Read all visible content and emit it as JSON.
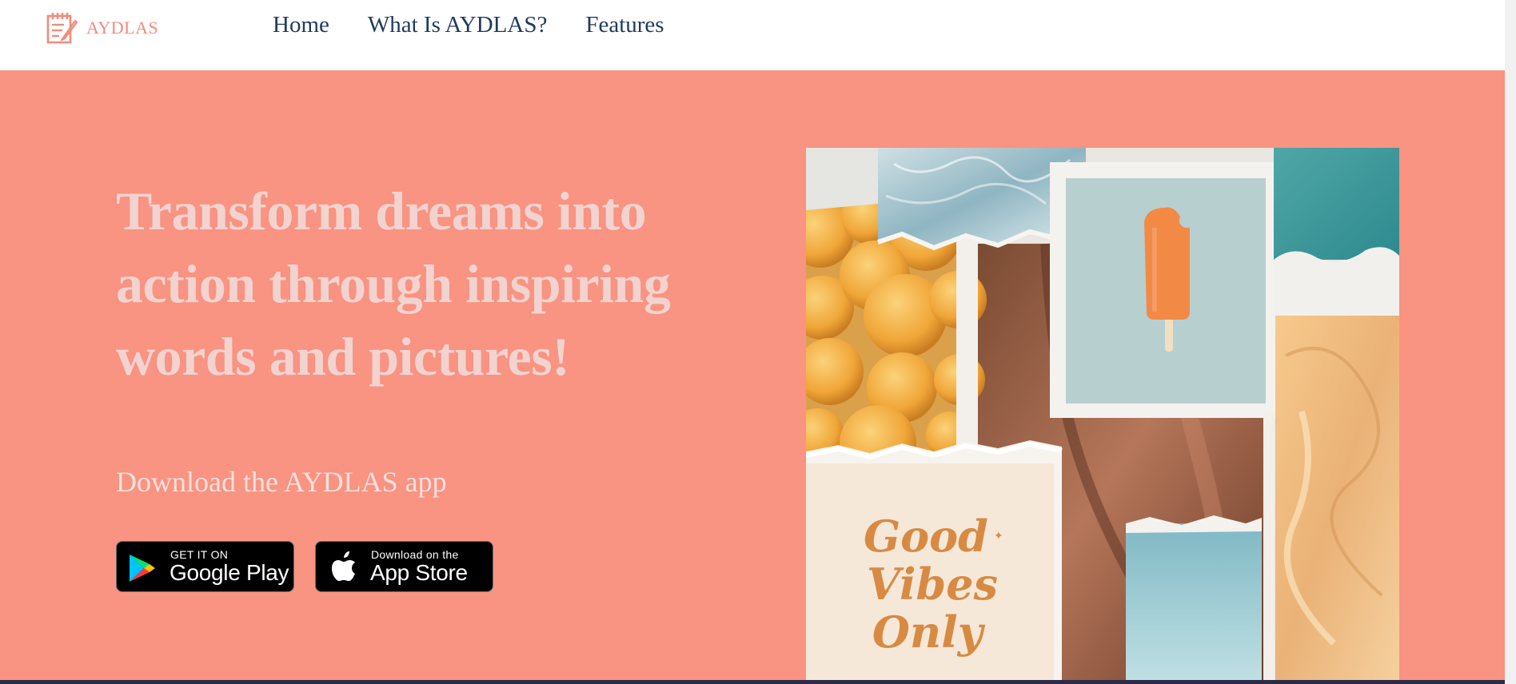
{
  "brand": {
    "name": "AYDLAS",
    "color": "#f08c7c",
    "icon": "notepad-pencil-icon"
  },
  "nav": {
    "links": [
      {
        "label": "Home"
      },
      {
        "label": "What Is AYDLAS?"
      },
      {
        "label": "Features"
      }
    ],
    "link_color": "#1f3a5f"
  },
  "hero": {
    "background": "#f99382",
    "headline": "Transform dreams into action through inspiring words and pictures!",
    "subheading": "Download the AYDLAS app",
    "buttons": [
      {
        "small": "GET IT ON",
        "large": "Google Play",
        "icon": "google-play-icon"
      },
      {
        "small": "Download on the",
        "large": "App Store",
        "icon": "apple-icon"
      }
    ],
    "collage_text": [
      "Good",
      "Vibes",
      "Only"
    ]
  }
}
